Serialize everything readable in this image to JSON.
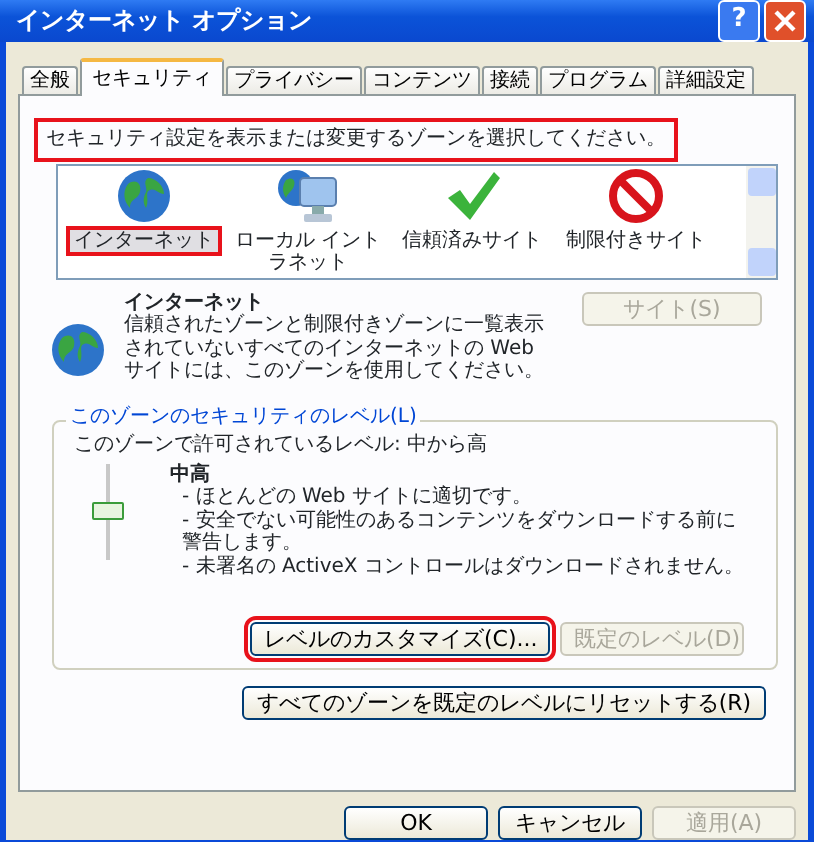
{
  "window": {
    "title": "インターネット オプション",
    "help": "?"
  },
  "tabs": [
    {
      "label": "全般",
      "selected": false
    },
    {
      "label": "セキュリティ",
      "selected": true
    },
    {
      "label": "プライバシー",
      "selected": false
    },
    {
      "label": "コンテンツ",
      "selected": false
    },
    {
      "label": "接続",
      "selected": false
    },
    {
      "label": "プログラム",
      "selected": false
    },
    {
      "label": "詳細設定",
      "selected": false
    }
  ],
  "instruction": {
    "text": "セキュリティ設定を表示または変更するゾーンを選択してください。",
    "highlighted": true
  },
  "zones": [
    {
      "kind": "globe",
      "label": "インターネット",
      "selected": true,
      "highlighted": true
    },
    {
      "kind": "intranet",
      "label": "ローカル イントラネット",
      "selected": false,
      "highlighted": false
    },
    {
      "kind": "trusted",
      "label": "信頼済みサイト",
      "selected": false,
      "highlighted": false
    },
    {
      "kind": "restricted",
      "label": "制限付きサイト",
      "selected": false,
      "highlighted": false
    }
  ],
  "zone_info": {
    "title": "インターネット",
    "description": "信頼されたゾーンと制限付きゾーンに一覧表示されていないすべてのインターネットの Web サイトには、このゾーンを使用してください。",
    "sites_button": {
      "label": "サイト(S)",
      "disabled": true
    }
  },
  "level_group": {
    "legend": "このゾーンのセキュリティのレベル(L)",
    "allowed": "このゾーンで許可されているレベル: 中から高",
    "level": 0.5,
    "level_name": "中高",
    "bullets": [
      "- ほとんどの Web サイトに適切です。",
      "- 安全でない可能性のあるコンテンツをダウンロードする前に警告します。",
      "- 未署名の ActiveX コントロールはダウンロードされません。"
    ],
    "buttons": [
      {
        "label": "レベルのカスタマイズ(C)...",
        "disabled": false,
        "highlighted": true
      },
      {
        "label": "既定のレベル(D)",
        "disabled": true,
        "highlighted": false
      }
    ]
  },
  "reset_button": {
    "label": "すべてのゾーンを既定のレベルにリセットする(R)",
    "disabled": false
  },
  "footer_buttons": [
    {
      "label": "OK",
      "disabled": false
    },
    {
      "label": "キャンセル",
      "disabled": false
    },
    {
      "label": "適用(A)",
      "disabled": true
    }
  ]
}
